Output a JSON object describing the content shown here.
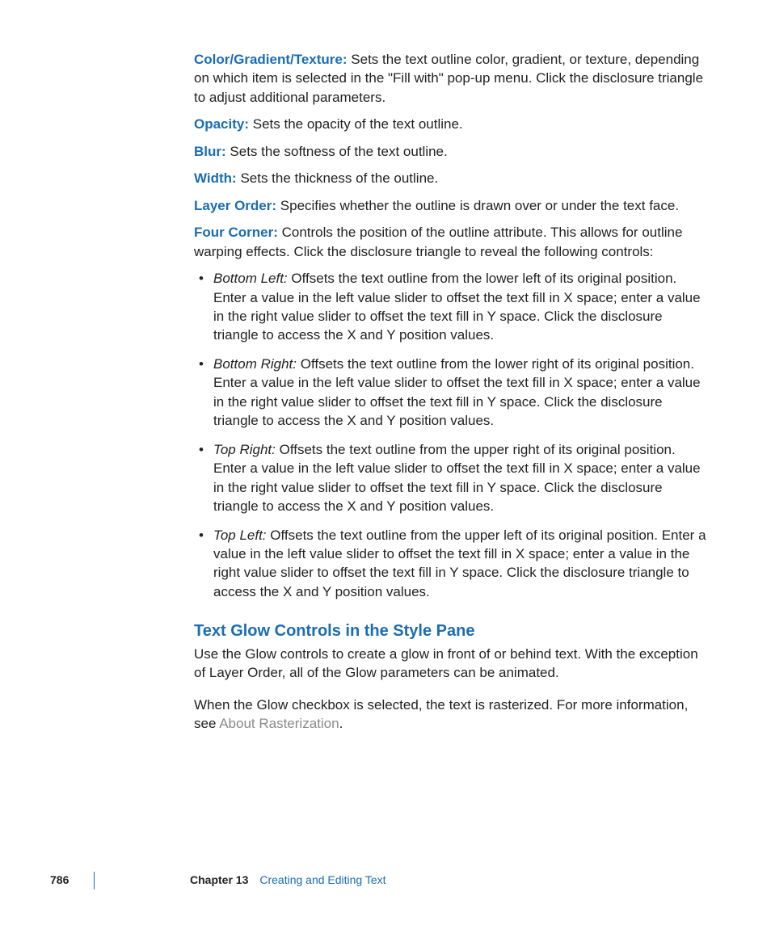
{
  "params": [
    {
      "term": "Color/Gradient/Texture:",
      "desc": " Sets the text outline color, gradient, or texture, depending on which item is selected in the \"Fill with\" pop-up menu. Click the disclosure triangle to adjust additional parameters."
    },
    {
      "term": "Opacity:",
      "desc": " Sets the opacity of the text outline."
    },
    {
      "term": "Blur:",
      "desc": " Sets the softness of the text outline."
    },
    {
      "term": "Width:",
      "desc": " Sets the thickness of the outline."
    },
    {
      "term": "Layer Order:",
      "desc": " Specifies whether the outline is drawn over or under the text face."
    },
    {
      "term": "Four Corner:",
      "desc": " Controls the position of the outline attribute. This allows for outline warping effects. Click the disclosure triangle to reveal the following controls:"
    }
  ],
  "bullets": [
    {
      "term": "Bottom Left:",
      "desc": " Offsets the text outline from the lower left of its original position. Enter a value in the left value slider to offset the text fill in X space; enter a value in the right value slider to offset the text fill in Y space. Click the disclosure triangle to access the X and Y position values."
    },
    {
      "term": "Bottom Right:",
      "desc": " Offsets the text outline from the lower right of its original position. Enter a value in the left value slider to offset the text fill in X space; enter a value in the right value slider to offset the text fill in Y space. Click the disclosure triangle to access the X and Y position values."
    },
    {
      "term": "Top Right:",
      "desc": " Offsets the text outline from the upper right of its original position. Enter a value in the left value slider to offset the text fill in X space; enter a value in the right value slider to offset the text fill in Y space. Click the disclosure triangle to access the X and Y position values."
    },
    {
      "term": "Top Left:",
      "desc": " Offsets the text outline from the upper left of its original position. Enter a value in the left value slider to offset the text fill in X space; enter a value in the right value slider to offset the text fill in Y space. Click the disclosure triangle to access the X and Y position values."
    }
  ],
  "section": {
    "heading": "Text Glow Controls in the Style Pane",
    "p1": "Use the Glow controls to create a glow in front of or behind text. With the exception of Layer Order, all of the Glow parameters can be animated.",
    "p2a": "When the Glow checkbox is selected, the text is rasterized. For more information, see ",
    "p2link": "About Rasterization",
    "p2b": "."
  },
  "footer": {
    "page": "786",
    "chapter_label": "Chapter 13",
    "chapter_name": "Creating and Editing Text"
  }
}
